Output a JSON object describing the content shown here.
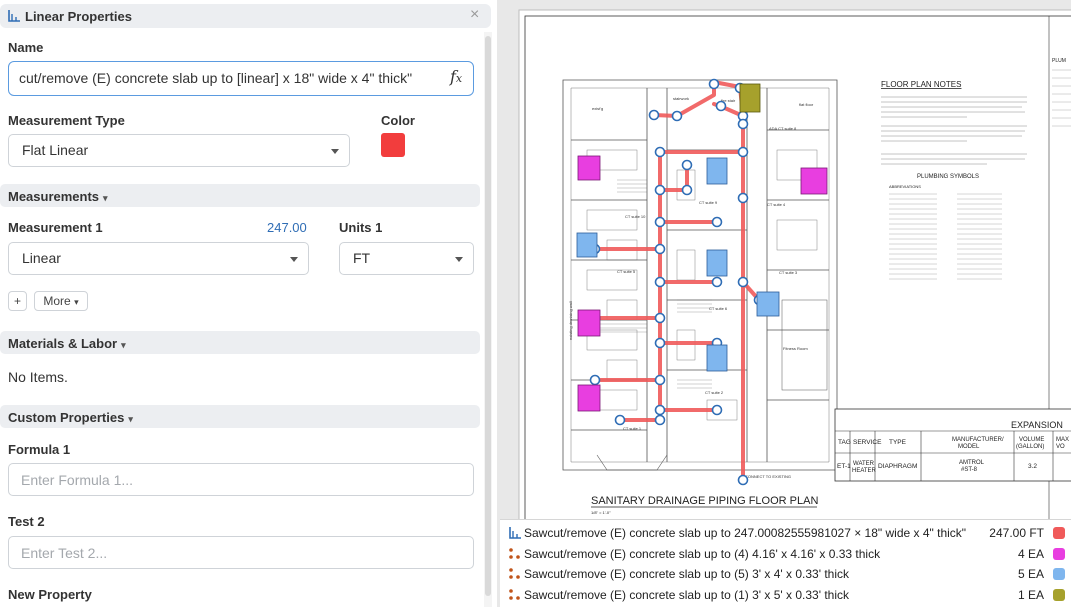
{
  "panel": {
    "title": "Linear Properties",
    "close_glyph": "×",
    "name_label": "Name",
    "name_value": "cut/remove (E) concrete slab up to [linear] x 18\" wide x 4\" thick\"",
    "fx_glyph": "fx",
    "measurement_type_label": "Measurement Type",
    "measurement_type_value": "Flat Linear",
    "color_label": "Color",
    "color_value": "#f23d3d",
    "measurements_section": "Measurements",
    "measurement1_label": "Measurement 1",
    "measurement1_value": "247.00",
    "units1_label": "Units 1",
    "measurement1_select": "Linear",
    "units1_select": "FT",
    "add_button": "+",
    "more_button": "More",
    "materials_section": "Materials & Labor",
    "no_items": "No Items.",
    "custom_section": "Custom Properties",
    "formula1_label": "Formula 1",
    "formula1_placeholder": "Enter Formula 1...",
    "test2_label": "Test 2",
    "test2_placeholder": "Enter Test 2...",
    "new_property_label": "New Property"
  },
  "drawing": {
    "floor_plan_notes_title": "FLOOR PLAN NOTES",
    "plumbing_symbols_title": "PLUMBING SYMBOLS",
    "abbreviations_title": "ABBREVIATIONS",
    "title": "SANITARY DRAINAGE PIPING FLOOR PLAN",
    "scale": "1/8\" = 1'-0\"",
    "right_edge_label": "PLUM",
    "room_labels": [
      "exist'g",
      "stairwork",
      "fire stair",
      "flat floor",
      "ADA CT suite 8",
      "CT suite 10",
      "CT suite 9",
      "CT suite 4",
      "CT suite 3",
      "CT suite 5",
      "CT suite 2",
      "CT suite 6",
      "CT suite 1",
      "Fitness Room"
    ],
    "connect_label": "CONNECT TO EXISTING",
    "vertical_label": "existing demising wall",
    "expansion_table": {
      "title": "EXPANSION",
      "headers": [
        "TAG",
        "SERVICE",
        "TYPE",
        "MANUFACTURER/ MODEL",
        "VOLUME (GALLON)",
        "MAX VO"
      ],
      "row": [
        "ET-1",
        "WATER HEATER",
        "DIAPHRAGM",
        "AMTROL #ST-8",
        "3.2",
        ""
      ]
    }
  },
  "legend": {
    "rows": [
      {
        "text": "Sawcut/remove (E) concrete slab up to 247.00082555981027 × 18\" wide x 4\" thick\"",
        "qty": "247.00 FT",
        "color": "#f05a5a",
        "icon": "linear-icon"
      },
      {
        "text": "Sawcut/remove (E) concrete slab up to (4) 4.16' x 4.16' x 0.33 thick",
        "qty": "4 EA",
        "color": "#e83ee0",
        "icon": "count-icon"
      },
      {
        "text": "Sawcut/remove (E) concrete slab up to (5) 3' x 4' x 0.33' thick",
        "qty": "5 EA",
        "color": "#7fb6ee",
        "icon": "count-icon"
      },
      {
        "text": "Sawcut/remove (E) concrete slab up to (1) 3' x 5' x 0.33' thick",
        "qty": "1 EA",
        "color": "#a6a12c",
        "icon": "count-icon"
      }
    ]
  }
}
